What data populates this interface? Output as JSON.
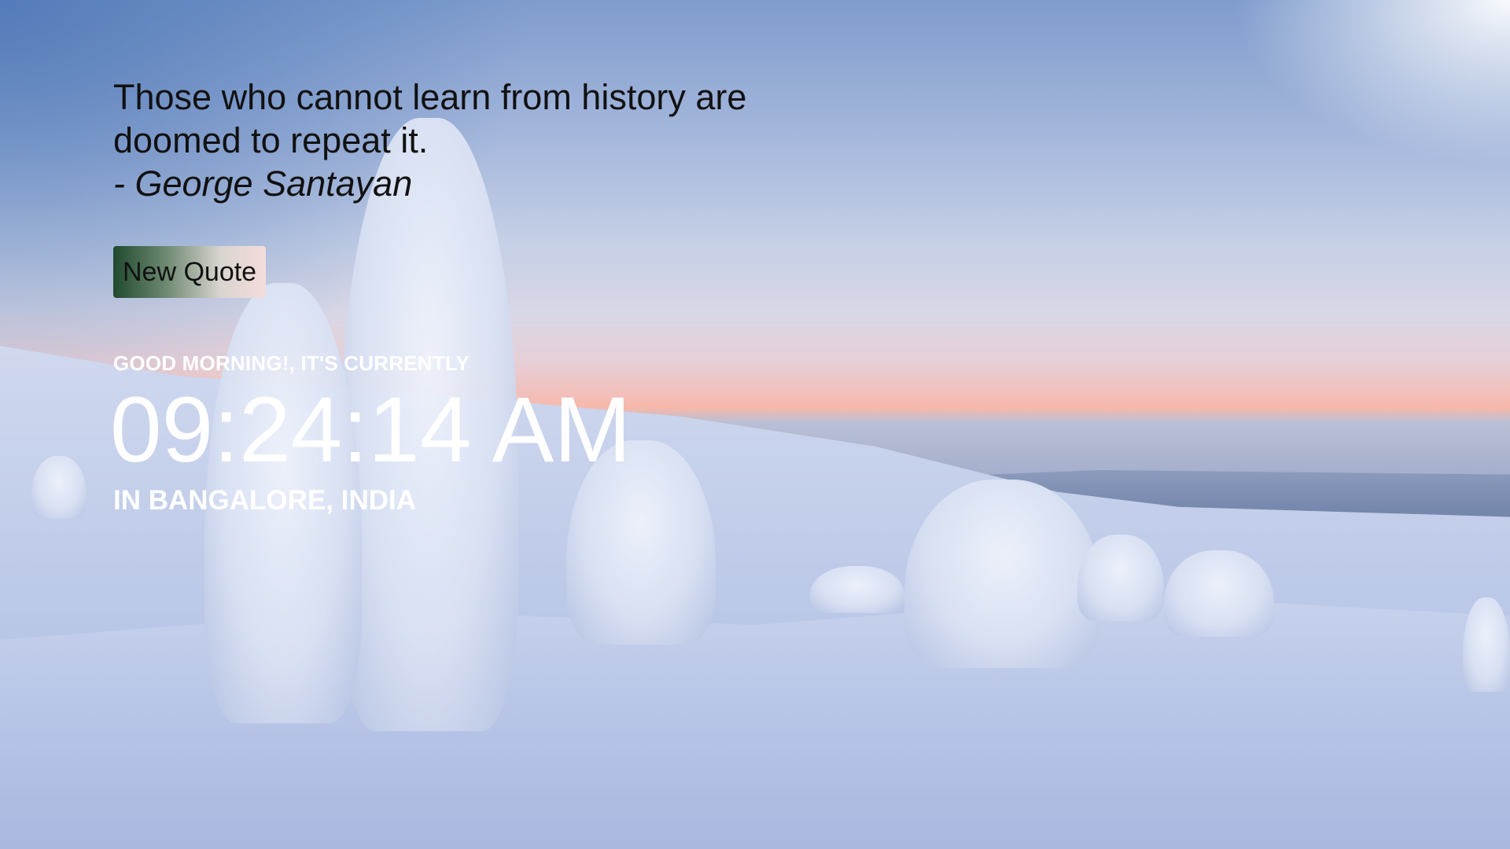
{
  "quote": {
    "line1": "Those who cannot learn from history are",
    "line2": "doomed to repeat it.",
    "author": "- George Santayan"
  },
  "button": {
    "new_quote_label": "New Quote",
    "gradient_colors": [
      "#1f4a2f",
      "#f5dcdc"
    ]
  },
  "clock": {
    "greeting": "GOOD MORNING!, IT'S CURRENTLY",
    "time": "09:24:14 AM",
    "location": "IN BANGALORE, INDIA"
  },
  "background": {
    "scene": "snowy-forest-sunrise",
    "accent_colors": [
      "#4c76b6",
      "#f7b8a9",
      "#c4cfea"
    ]
  }
}
